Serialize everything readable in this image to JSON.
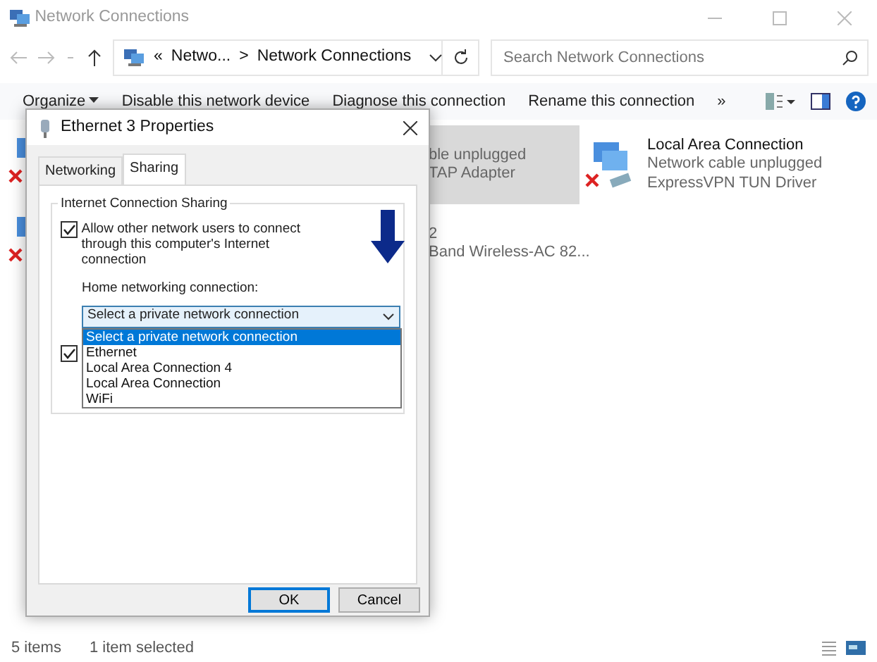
{
  "window": {
    "title": "Network Connections"
  },
  "address_bar": {
    "path": [
      "«",
      "Netwo...",
      ">",
      "Network Connections"
    ]
  },
  "search": {
    "placeholder": "Search Network Connections"
  },
  "toolbar": {
    "items": [
      {
        "label": "Organize",
        "dropdown": true
      },
      {
        "label": "Disable this network device",
        "dropdown": false
      },
      {
        "label": "Diagnose this connection",
        "dropdown": false
      },
      {
        "label": "Rename this connection",
        "dropdown": false
      },
      {
        "label": "»",
        "dropdown": false
      }
    ]
  },
  "connections": [
    {
      "kind": "icon",
      "disconnected": true,
      "selected": false
    },
    {
      "kind": "partial",
      "lines": [
        "ble unplugged",
        "TAP Adapter"
      ],
      "selected": true
    },
    {
      "kind": "full",
      "name": "Local Area Connection",
      "status": "Network cable unplugged",
      "device": "ExpressVPN TUN Driver",
      "disconnected": true,
      "selected": false
    },
    {
      "kind": "icon",
      "disconnected": true,
      "selected": false
    },
    {
      "kind": "partial",
      "lines": [
        "2",
        "Band Wireless-AC 82..."
      ],
      "selected": false
    }
  ],
  "status_bar": {
    "count": "5 items",
    "selection": "1 item selected"
  },
  "dialog": {
    "title": "Ethernet 3 Properties",
    "tabs": [
      {
        "label": "Networking",
        "selected": false
      },
      {
        "label": "Sharing",
        "selected": true
      }
    ],
    "group_title": "Internet Connection Sharing",
    "allow_connect": {
      "label": "Allow other network users to connect through this computer's Internet connection",
      "checked": true
    },
    "home_label": "Home networking connection:",
    "combo": {
      "value": "Select a private network connection",
      "expanded": true,
      "options": [
        {
          "label": "Select a private network connection",
          "selected": true
        },
        {
          "label": "Ethernet",
          "selected": false
        },
        {
          "label": "Local Area Connection 4",
          "selected": false
        },
        {
          "label": "Local Area Connection",
          "selected": false
        },
        {
          "label": "WiFi",
          "selected": false
        }
      ]
    },
    "allow_control": {
      "checked": true
    },
    "buttons": [
      {
        "label": "OK",
        "default": true
      },
      {
        "label": "Cancel",
        "default": false
      }
    ]
  }
}
